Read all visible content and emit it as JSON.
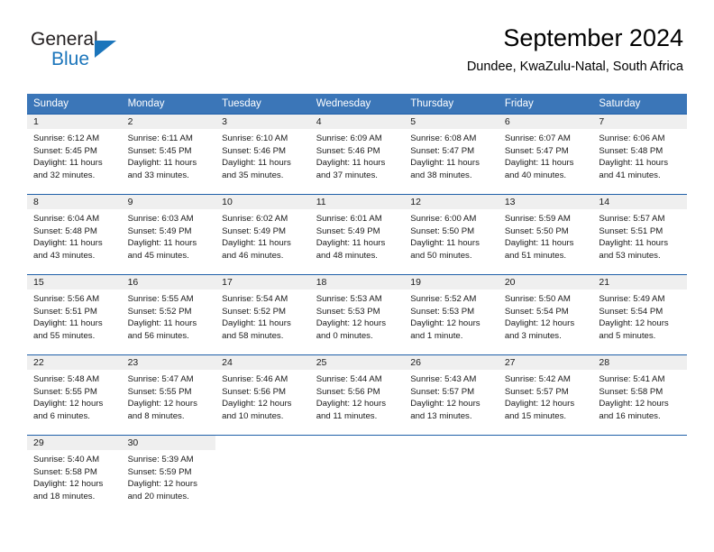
{
  "brand": {
    "name_part1": "General",
    "name_part2": "Blue",
    "accent_color": "#1b75bb"
  },
  "header": {
    "title": "September 2024",
    "location": "Dundee, KwaZulu-Natal, South Africa"
  },
  "theme": {
    "header_row_bg": "#3b76b8",
    "week_separator": "#1f5fa9",
    "day_band_bg": "#efefef"
  },
  "columns": [
    "Sunday",
    "Monday",
    "Tuesday",
    "Wednesday",
    "Thursday",
    "Friday",
    "Saturday"
  ],
  "weeks": [
    [
      {
        "day": "1",
        "sunrise": "Sunrise: 6:12 AM",
        "sunset": "Sunset: 5:45 PM",
        "daylight1": "Daylight: 11 hours",
        "daylight2": "and 32 minutes."
      },
      {
        "day": "2",
        "sunrise": "Sunrise: 6:11 AM",
        "sunset": "Sunset: 5:45 PM",
        "daylight1": "Daylight: 11 hours",
        "daylight2": "and 33 minutes."
      },
      {
        "day": "3",
        "sunrise": "Sunrise: 6:10 AM",
        "sunset": "Sunset: 5:46 PM",
        "daylight1": "Daylight: 11 hours",
        "daylight2": "and 35 minutes."
      },
      {
        "day": "4",
        "sunrise": "Sunrise: 6:09 AM",
        "sunset": "Sunset: 5:46 PM",
        "daylight1": "Daylight: 11 hours",
        "daylight2": "and 37 minutes."
      },
      {
        "day": "5",
        "sunrise": "Sunrise: 6:08 AM",
        "sunset": "Sunset: 5:47 PM",
        "daylight1": "Daylight: 11 hours",
        "daylight2": "and 38 minutes."
      },
      {
        "day": "6",
        "sunrise": "Sunrise: 6:07 AM",
        "sunset": "Sunset: 5:47 PM",
        "daylight1": "Daylight: 11 hours",
        "daylight2": "and 40 minutes."
      },
      {
        "day": "7",
        "sunrise": "Sunrise: 6:06 AM",
        "sunset": "Sunset: 5:48 PM",
        "daylight1": "Daylight: 11 hours",
        "daylight2": "and 41 minutes."
      }
    ],
    [
      {
        "day": "8",
        "sunrise": "Sunrise: 6:04 AM",
        "sunset": "Sunset: 5:48 PM",
        "daylight1": "Daylight: 11 hours",
        "daylight2": "and 43 minutes."
      },
      {
        "day": "9",
        "sunrise": "Sunrise: 6:03 AM",
        "sunset": "Sunset: 5:49 PM",
        "daylight1": "Daylight: 11 hours",
        "daylight2": "and 45 minutes."
      },
      {
        "day": "10",
        "sunrise": "Sunrise: 6:02 AM",
        "sunset": "Sunset: 5:49 PM",
        "daylight1": "Daylight: 11 hours",
        "daylight2": "and 46 minutes."
      },
      {
        "day": "11",
        "sunrise": "Sunrise: 6:01 AM",
        "sunset": "Sunset: 5:49 PM",
        "daylight1": "Daylight: 11 hours",
        "daylight2": "and 48 minutes."
      },
      {
        "day": "12",
        "sunrise": "Sunrise: 6:00 AM",
        "sunset": "Sunset: 5:50 PM",
        "daylight1": "Daylight: 11 hours",
        "daylight2": "and 50 minutes."
      },
      {
        "day": "13",
        "sunrise": "Sunrise: 5:59 AM",
        "sunset": "Sunset: 5:50 PM",
        "daylight1": "Daylight: 11 hours",
        "daylight2": "and 51 minutes."
      },
      {
        "day": "14",
        "sunrise": "Sunrise: 5:57 AM",
        "sunset": "Sunset: 5:51 PM",
        "daylight1": "Daylight: 11 hours",
        "daylight2": "and 53 minutes."
      }
    ],
    [
      {
        "day": "15",
        "sunrise": "Sunrise: 5:56 AM",
        "sunset": "Sunset: 5:51 PM",
        "daylight1": "Daylight: 11 hours",
        "daylight2": "and 55 minutes."
      },
      {
        "day": "16",
        "sunrise": "Sunrise: 5:55 AM",
        "sunset": "Sunset: 5:52 PM",
        "daylight1": "Daylight: 11 hours",
        "daylight2": "and 56 minutes."
      },
      {
        "day": "17",
        "sunrise": "Sunrise: 5:54 AM",
        "sunset": "Sunset: 5:52 PM",
        "daylight1": "Daylight: 11 hours",
        "daylight2": "and 58 minutes."
      },
      {
        "day": "18",
        "sunrise": "Sunrise: 5:53 AM",
        "sunset": "Sunset: 5:53 PM",
        "daylight1": "Daylight: 12 hours",
        "daylight2": "and 0 minutes."
      },
      {
        "day": "19",
        "sunrise": "Sunrise: 5:52 AM",
        "sunset": "Sunset: 5:53 PM",
        "daylight1": "Daylight: 12 hours",
        "daylight2": "and 1 minute."
      },
      {
        "day": "20",
        "sunrise": "Sunrise: 5:50 AM",
        "sunset": "Sunset: 5:54 PM",
        "daylight1": "Daylight: 12 hours",
        "daylight2": "and 3 minutes."
      },
      {
        "day": "21",
        "sunrise": "Sunrise: 5:49 AM",
        "sunset": "Sunset: 5:54 PM",
        "daylight1": "Daylight: 12 hours",
        "daylight2": "and 5 minutes."
      }
    ],
    [
      {
        "day": "22",
        "sunrise": "Sunrise: 5:48 AM",
        "sunset": "Sunset: 5:55 PM",
        "daylight1": "Daylight: 12 hours",
        "daylight2": "and 6 minutes."
      },
      {
        "day": "23",
        "sunrise": "Sunrise: 5:47 AM",
        "sunset": "Sunset: 5:55 PM",
        "daylight1": "Daylight: 12 hours",
        "daylight2": "and 8 minutes."
      },
      {
        "day": "24",
        "sunrise": "Sunrise: 5:46 AM",
        "sunset": "Sunset: 5:56 PM",
        "daylight1": "Daylight: 12 hours",
        "daylight2": "and 10 minutes."
      },
      {
        "day": "25",
        "sunrise": "Sunrise: 5:44 AM",
        "sunset": "Sunset: 5:56 PM",
        "daylight1": "Daylight: 12 hours",
        "daylight2": "and 11 minutes."
      },
      {
        "day": "26",
        "sunrise": "Sunrise: 5:43 AM",
        "sunset": "Sunset: 5:57 PM",
        "daylight1": "Daylight: 12 hours",
        "daylight2": "and 13 minutes."
      },
      {
        "day": "27",
        "sunrise": "Sunrise: 5:42 AM",
        "sunset": "Sunset: 5:57 PM",
        "daylight1": "Daylight: 12 hours",
        "daylight2": "and 15 minutes."
      },
      {
        "day": "28",
        "sunrise": "Sunrise: 5:41 AM",
        "sunset": "Sunset: 5:58 PM",
        "daylight1": "Daylight: 12 hours",
        "daylight2": "and 16 minutes."
      }
    ],
    [
      {
        "day": "29",
        "sunrise": "Sunrise: 5:40 AM",
        "sunset": "Sunset: 5:58 PM",
        "daylight1": "Daylight: 12 hours",
        "daylight2": "and 18 minutes."
      },
      {
        "day": "30",
        "sunrise": "Sunrise: 5:39 AM",
        "sunset": "Sunset: 5:59 PM",
        "daylight1": "Daylight: 12 hours",
        "daylight2": "and 20 minutes."
      },
      {
        "day": "",
        "sunrise": "",
        "sunset": "",
        "daylight1": "",
        "daylight2": ""
      },
      {
        "day": "",
        "sunrise": "",
        "sunset": "",
        "daylight1": "",
        "daylight2": ""
      },
      {
        "day": "",
        "sunrise": "",
        "sunset": "",
        "daylight1": "",
        "daylight2": ""
      },
      {
        "day": "",
        "sunrise": "",
        "sunset": "",
        "daylight1": "",
        "daylight2": ""
      },
      {
        "day": "",
        "sunrise": "",
        "sunset": "",
        "daylight1": "",
        "daylight2": ""
      }
    ]
  ]
}
